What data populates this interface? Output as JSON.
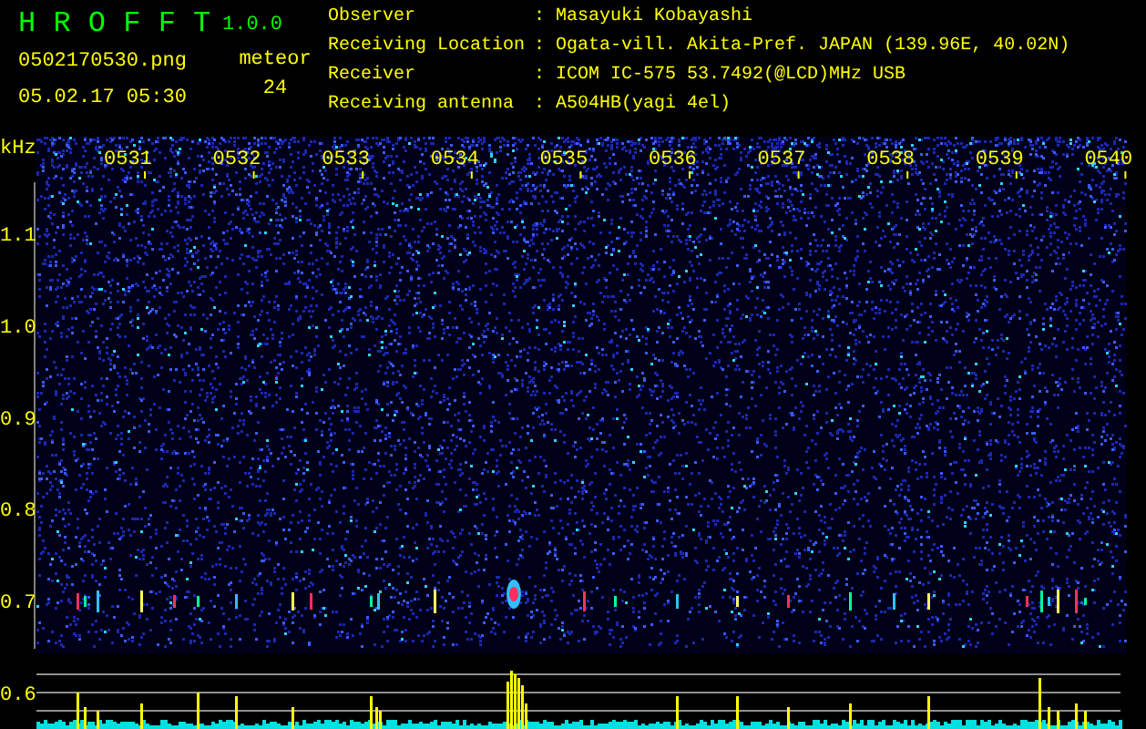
{
  "app": {
    "name": "H R O F F T",
    "version": "1.0.0"
  },
  "file": "0502170530.png",
  "datetime": "05.02.17 05:30",
  "meteor": {
    "label": "meteor",
    "count": "24"
  },
  "info": [
    {
      "label": "Observer",
      "separator": ":",
      "value": "Masayuki Kobayashi"
    },
    {
      "label": "Receiving Location",
      "separator": ":",
      "value": "Ogata-vill. Akita-Pref. JAPAN (139.96E, 40.02N)"
    },
    {
      "label": "Receiver",
      "separator": ":",
      "value": "ICOM IC-575 53.7492(@LCD)MHz USB"
    },
    {
      "label": "Receiving antenna",
      "separator": ":",
      "value": "A504HB(yagi 4el)"
    }
  ],
  "spectrogram": {
    "unit": "kHz",
    "time_labels": [
      "0531",
      "0532",
      "0533",
      "0534",
      "0535",
      "0536",
      "0537",
      "0538",
      "0539",
      "0540"
    ],
    "frequency_labels": [
      "1.1",
      "1.0",
      "0.9",
      "0.8",
      "0.7",
      "0.6"
    ]
  }
}
